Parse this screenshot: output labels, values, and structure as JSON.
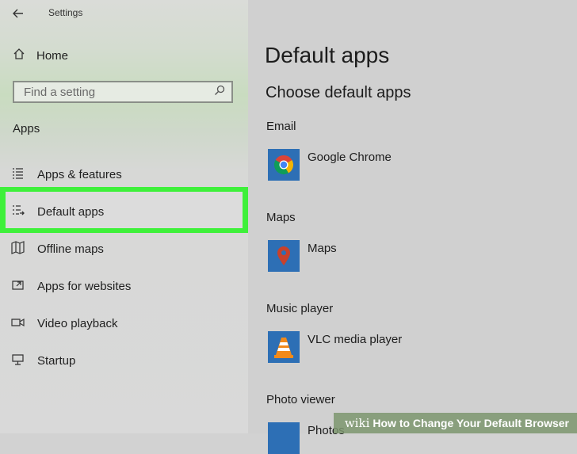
{
  "window": {
    "title": "Settings"
  },
  "sidebar": {
    "home_label": "Home",
    "search_placeholder": "Find a setting",
    "section_heading": "Apps",
    "items": [
      {
        "label": "Apps & features",
        "icon": "apps-features-icon"
      },
      {
        "label": "Default apps",
        "icon": "default-apps-icon",
        "selected": true
      },
      {
        "label": "Offline maps",
        "icon": "offline-maps-icon"
      },
      {
        "label": "Apps for websites",
        "icon": "apps-for-websites-icon"
      },
      {
        "label": "Video playback",
        "icon": "video-playback-icon"
      },
      {
        "label": "Startup",
        "icon": "startup-icon"
      }
    ]
  },
  "main": {
    "title": "Default apps",
    "subtitle": "Choose default apps",
    "categories": [
      {
        "label": "Email",
        "app": "Google Chrome",
        "icon": "chrome-icon"
      },
      {
        "label": "Maps",
        "app": "Maps",
        "icon": "maps-pin-icon"
      },
      {
        "label": "Music player",
        "app": "VLC media player",
        "icon": "vlc-cone-icon"
      },
      {
        "label": "Photo viewer",
        "app": "Photos",
        "icon": "photos-icon"
      }
    ]
  },
  "watermark": {
    "brand": "wiki",
    "text": "How to Change Your Default Browser"
  },
  "colors": {
    "highlight": "#3ef03a",
    "tile_blue": "#2d6fb5"
  }
}
